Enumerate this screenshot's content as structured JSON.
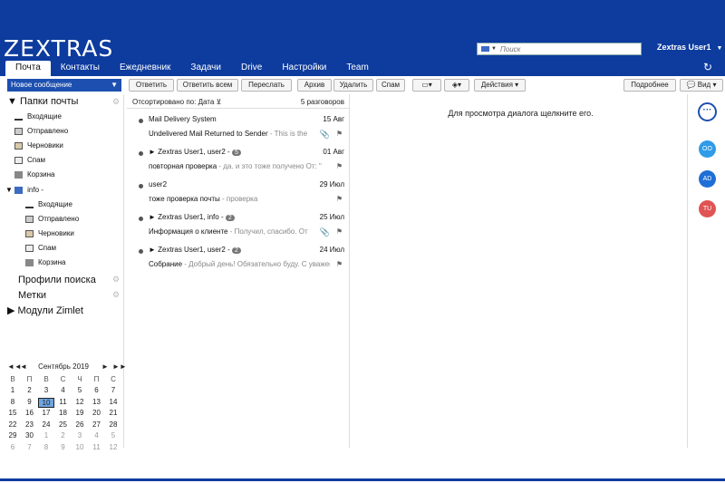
{
  "header": {
    "logo": "ZEXTRAS",
    "search_placeholder": "Поиск",
    "user": "Zextras User1"
  },
  "tabs": [
    "Почта",
    "Контакты",
    "Ежедневник",
    "Задачи",
    "Drive",
    "Настройки",
    "Team"
  ],
  "toolbar": {
    "new_message": "Новое сообщение",
    "reply": "Ответить",
    "reply_all": "Ответить всем",
    "forward": "Переслать",
    "archive": "Архив",
    "delete": "Удалить",
    "spam": "Спам",
    "actions": "Действия",
    "details": "Подробнее",
    "view": "Вид"
  },
  "sidebar": {
    "mail_folders": "Папки почты",
    "folders": [
      "Входящие",
      "Отправлено",
      "Черновики",
      "Спам",
      "Корзина"
    ],
    "account": "info -",
    "account_folders": [
      "Входящие",
      "Отправлено",
      "Черновики",
      "Спам",
      "Корзина"
    ],
    "search_profiles": "Профили поиска",
    "tags": "Метки",
    "zimlets": "Модули Zimlet"
  },
  "calendar": {
    "title": "Сентябрь 2019",
    "days": [
      "В",
      "П",
      "В",
      "С",
      "Ч",
      "П",
      "С"
    ],
    "weeks": [
      [
        "1",
        "2",
        "3",
        "4",
        "5",
        "6",
        "7"
      ],
      [
        "8",
        "9",
        "10",
        "11",
        "12",
        "13",
        "14"
      ],
      [
        "15",
        "16",
        "17",
        "18",
        "19",
        "20",
        "21"
      ],
      [
        "22",
        "23",
        "24",
        "25",
        "26",
        "27",
        "28"
      ],
      [
        "29",
        "30",
        "1",
        "2",
        "3",
        "4",
        "5"
      ],
      [
        "6",
        "7",
        "8",
        "9",
        "10",
        "11",
        "12"
      ]
    ],
    "selected": "10"
  },
  "list": {
    "sort": "Отсортировано по: Дата",
    "count": "5 разговоров",
    "rows": [
      {
        "from": "Mail Delivery System",
        "date": "15 Авг",
        "subject": "Undelivered Mail Returned to Sender",
        "fragment": " - This is the",
        "badge": "",
        "clip": true
      },
      {
        "from": "► Zextras User1, user2 -",
        "date": "01 Авг",
        "subject": "повторная проверка",
        "fragment": " - да. и это тоже получено От: \"",
        "badge": "5",
        "clip": false
      },
      {
        "from": "user2",
        "date": "29 Июл",
        "subject": "тоже проверка почты",
        "fragment": " - проверка",
        "badge": "",
        "clip": false
      },
      {
        "from": "► Zextras User1, info -",
        "date": "25 Июл",
        "subject": "Информация о клиенте",
        "fragment": " - Получил, спасибо. От",
        "badge": "2",
        "clip": true
      },
      {
        "from": "► Zextras User1, user2 -",
        "date": "24 Июл",
        "subject": "Собрание",
        "fragment": " - Добрый день! Обязательно буду. С уважением",
        "badge": "2",
        "clip": false
      }
    ]
  },
  "reading": {
    "hint": "Для просмотра диалога щелкните его."
  },
  "avatars": [
    {
      "initials": "OO",
      "color": "#2f9be9"
    },
    {
      "initials": "AD",
      "color": "#1f6fd6"
    },
    {
      "initials": "TU",
      "color": "#e05454"
    }
  ],
  "colors": {
    "brand": "#0d3b9e",
    "accent": "#1d4fb0"
  }
}
